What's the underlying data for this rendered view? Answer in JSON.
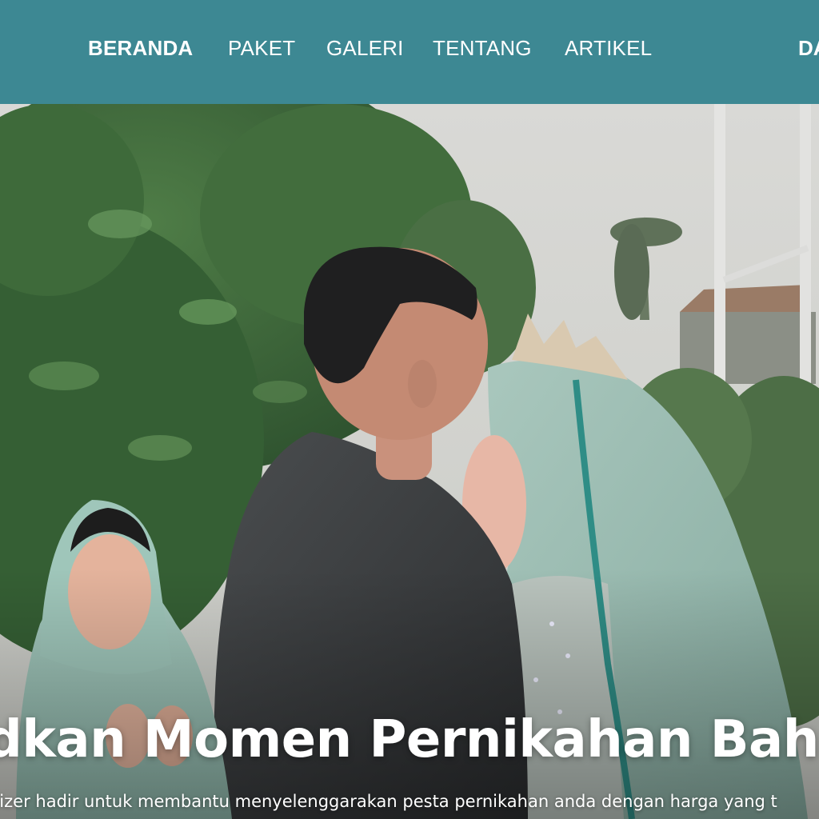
{
  "nav": {
    "links": [
      {
        "label": "BERANDA",
        "active": true
      },
      {
        "label": "PAKET",
        "active": false
      },
      {
        "label": "GALERI",
        "active": false
      },
      {
        "label": "TENTANG",
        "active": false
      },
      {
        "label": "ARTIKEL",
        "active": false
      }
    ],
    "cta_label": "DA"
  },
  "hero": {
    "title": "dkan Momen Pernikahan Bah",
    "subtitle": "nizer hadir untuk membantu menyelenggarakan pesta pernikahan anda dengan harga yang t"
  },
  "colors": {
    "navbar_bg": "#3d8893",
    "text": "#ffffff"
  }
}
